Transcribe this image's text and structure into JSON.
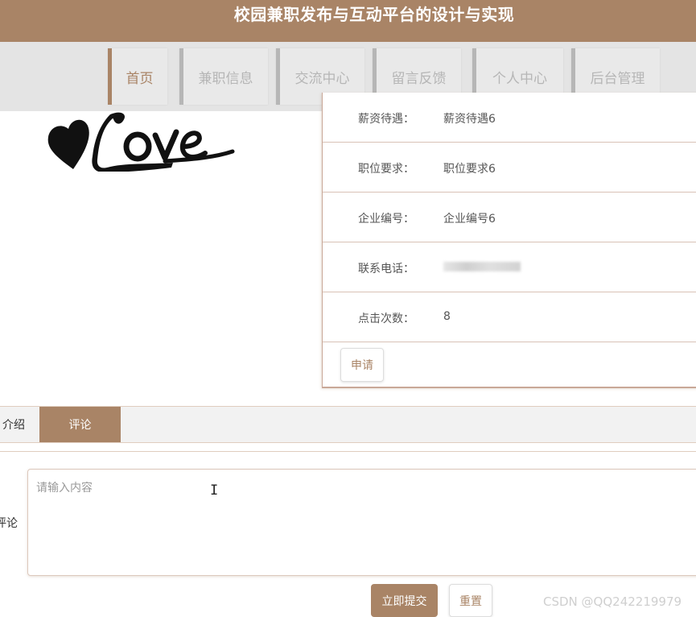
{
  "header": {
    "title": "校园兼职发布与互动平台的设计与实现"
  },
  "nav": {
    "items": [
      {
        "label": "首页",
        "active": true
      },
      {
        "label": "兼职信息",
        "active": false
      },
      {
        "label": "交流中心",
        "active": false
      },
      {
        "label": "留言反馈",
        "active": false
      },
      {
        "label": "个人中心",
        "active": false
      },
      {
        "label": "后台管理",
        "active": false
      }
    ]
  },
  "detail": {
    "rows": [
      {
        "label": "薪资待遇：",
        "value": "薪资待遇6"
      },
      {
        "label": "职位要求：",
        "value": "职位要求6"
      },
      {
        "label": "企业编号：",
        "value": "企业编号6"
      },
      {
        "label": "联系电话：",
        "value": ""
      },
      {
        "label": "点击次数：",
        "value": "8"
      }
    ],
    "apply_label": "申请"
  },
  "tabs": [
    {
      "label": "介绍",
      "active": false
    },
    {
      "label": "评论",
      "active": true
    }
  ],
  "comment": {
    "label": "评论",
    "placeholder": "请输入内容",
    "value": "",
    "submit_label": "立即提交",
    "reset_label": "重置"
  },
  "watermark": "CSDN @QQ242219979",
  "colors": {
    "accent": "#a98466",
    "nav_bg": "#e4e4e4",
    "nav_inactive": "#b6b6b6"
  }
}
